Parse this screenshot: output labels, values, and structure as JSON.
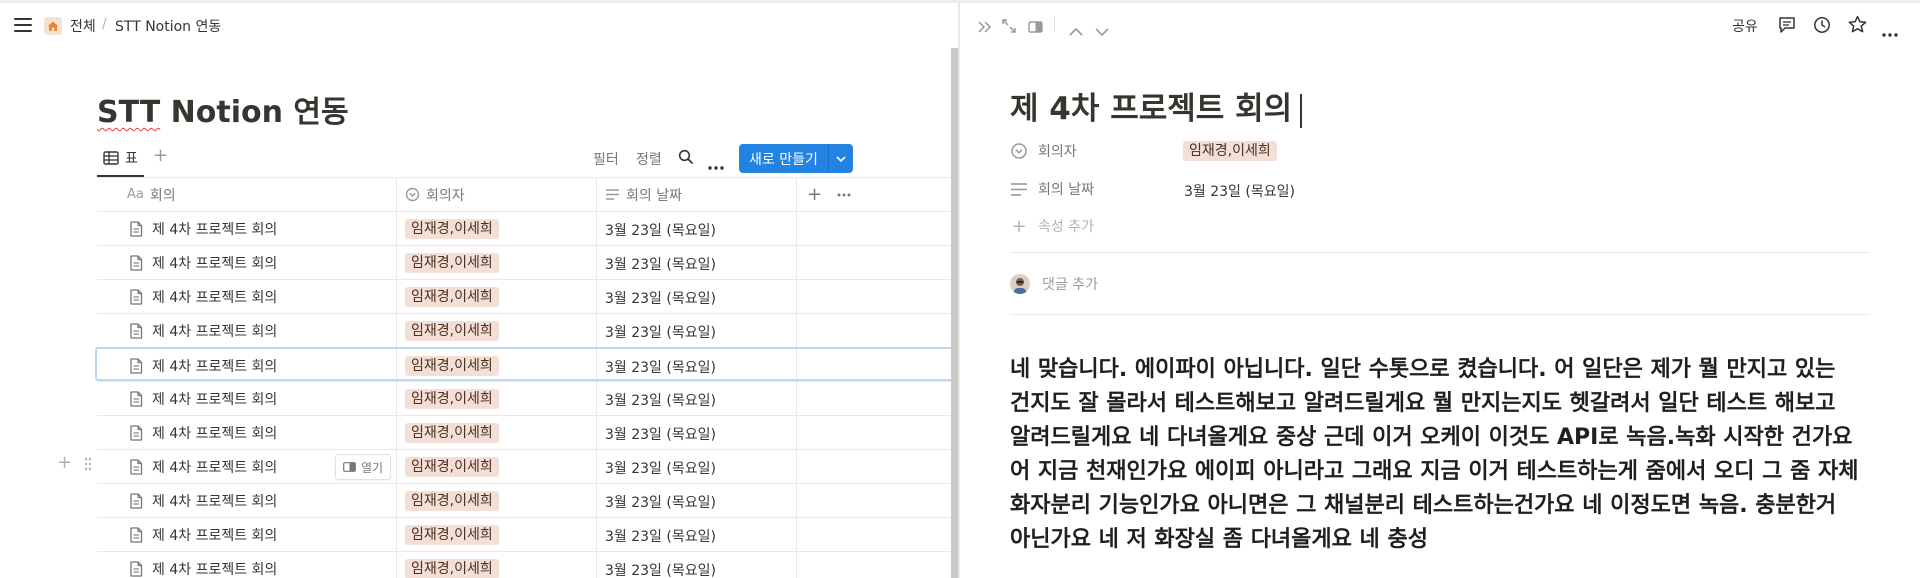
{
  "breadcrumb": {
    "home": "전체",
    "sep": "/",
    "page": "STT Notion 연동"
  },
  "page": {
    "title_part1": "STT",
    "title_part2": " Notion 연동"
  },
  "views": {
    "table_tab": "표"
  },
  "toolbar": {
    "filter": "필터",
    "sort": "정렬",
    "new_button": "새로 만들기"
  },
  "columns": {
    "name": "회의",
    "attendees": "회의자",
    "date": "회의 날짜"
  },
  "rows": [
    {
      "name": "제 4차 프로젝트 회의",
      "attendees": "임재경,이세희",
      "date": "3월 23일 (목요일)"
    },
    {
      "name": "제 4차 프로젝트 회의",
      "attendees": "임재경,이세희",
      "date": "3월 23일 (목요일)"
    },
    {
      "name": "제 4차 프로젝트 회의",
      "attendees": "임재경,이세희",
      "date": "3월 23일 (목요일)"
    },
    {
      "name": "제 4차 프로젝트 회의",
      "attendees": "임재경,이세희",
      "date": "3월 23일 (목요일)"
    },
    {
      "name": "제 4차 프로젝트 회의",
      "attendees": "임재경,이세희",
      "date": "3월 23일 (목요일)"
    },
    {
      "name": "제 4차 프로젝트 회의",
      "attendees": "임재경,이세희",
      "date": "3월 23일 (목요일)"
    },
    {
      "name": "제 4차 프로젝트 회의",
      "attendees": "임재경,이세희",
      "date": "3월 23일 (목요일)"
    },
    {
      "name": "제 4차 프로젝트 회의",
      "attendees": "임재경,이세희",
      "date": "3월 23일 (목요일)"
    },
    {
      "name": "제 4차 프로젝트 회의",
      "attendees": "임재경,이세희",
      "date": "3월 23일 (목요일)"
    },
    {
      "name": "제 4차 프로젝트 회의",
      "attendees": "임재경,이세희",
      "date": "3월 23일 (목요일)"
    },
    {
      "name": "제 4차 프로젝트 회의",
      "attendees": "임재경,이세희",
      "date": "3월 23일 (목요일)"
    }
  ],
  "row_actions": {
    "open": "열기"
  },
  "detail": {
    "share": "공유",
    "title": "제 4차 프로젝트 회의",
    "prop_attendees_label": "회의자",
    "prop_attendees_value": "임재경,이세희",
    "prop_date_label": "회의 날짜",
    "prop_date_value": "3월 23일 (목요일)",
    "add_property": "속성 추가",
    "add_comment": "댓글 추가",
    "body": "네 맞습니다. 에이파이 아닙니다. 일단 수톳으로 켰습니다. 어 일단은 제가 뭘 만지고 있는 건지도 잘 몰라서 테스트해보고 알려드릴게요 뭘 만지는지도 헷갈려서 일단 테스트 해보고 알려드릴게요 네 다녀올게요 중상 근데 이거 오케이 이것도 API로 녹음.녹화 시작한 건가요 어 지금 천재인가요 에이피 아니라고 그래요 지금 이거 테스트하는게 줌에서 오디 그 줌 자체 화자분리 기능인가요 아니면은 그 채널분리 테스트하는건가요 네 이정도면 녹음. 충분한거 아닌가요 네 저 화장실 좀 다녀올게요 네 충성"
  },
  "colors": {
    "accent": "#2383e2",
    "tag_bg": "#f4dfd7",
    "home_icon": "#f0822e"
  }
}
